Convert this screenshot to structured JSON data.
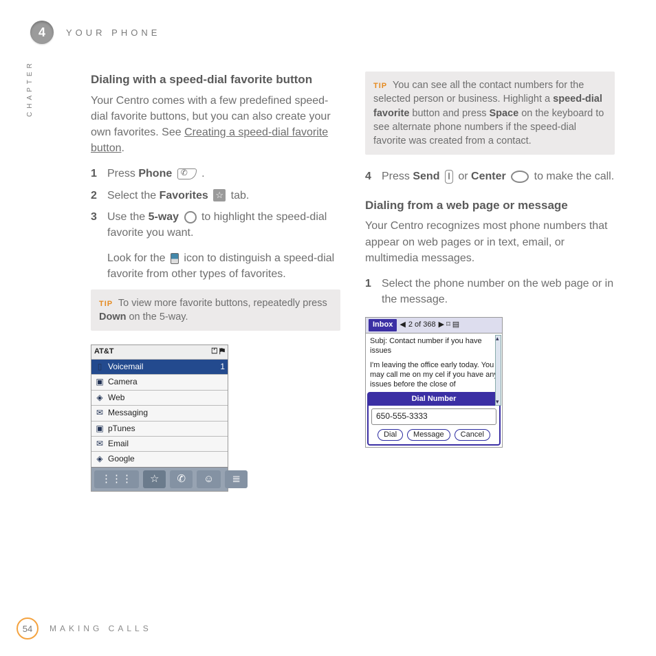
{
  "header": {
    "chapter_no": "4",
    "title": "YOUR PHONE",
    "side": "CHAPTER"
  },
  "left": {
    "h": "Dialing with a speed-dial favorite button",
    "intro_a": "Your Centro comes with a few predefined speed-dial favorite buttons, but you can also create your own favorites. See ",
    "intro_link": "Creating a speed-dial favorite button",
    "intro_b": ".",
    "s1_a": "Press ",
    "s1_b": "Phone",
    "s1_c": " .",
    "s2_a": "Select the ",
    "s2_b": "Favorites",
    "s2_c": " tab.",
    "s3_a": "Use the ",
    "s3_b": "5-way",
    "s3_c": " to highlight the speed-dial favorite you want.",
    "s3_look_a": "Look for the ",
    "s3_look_b": " icon to distinguish a speed-dial favorite from other types of favorites.",
    "tip_label": "TIP",
    "tip_a": " To view more favorite buttons, repeatedly press ",
    "tip_b": "Down",
    "tip_c": " on the 5-way.",
    "fav": {
      "carrier": "AT&T",
      "rows": [
        {
          "icon": "▯",
          "label": "Voicemail",
          "badge": "1",
          "sel": true
        },
        {
          "icon": "▣",
          "label": "Camera"
        },
        {
          "icon": "◈",
          "label": "Web"
        },
        {
          "icon": "✉",
          "label": "Messaging"
        },
        {
          "icon": "▣",
          "label": "pTunes"
        },
        {
          "icon": "✉",
          "label": "Email"
        },
        {
          "icon": "◈",
          "label": "Google"
        }
      ]
    }
  },
  "right": {
    "tip_label": "TIP",
    "tip_a": " You can see all the contact numbers for the selected person or business. Highlight a ",
    "tip_b": "speed-dial favorite",
    "tip_c": " button and press ",
    "tip_d": "Space",
    "tip_e": " on the keyboard to see alternate phone numbers if the speed-dial favorite was created from a contact.",
    "s4_a": "Press ",
    "s4_b": "Send",
    "s4_c": " or ",
    "s4_d": "Center",
    "s4_e": " to make the call.",
    "h2": "Dialing from a web page or message",
    "p2": "Your Centro recognizes most phone numbers that appear on web pages or in text, email, or multimedia messages.",
    "s1": "Select the phone number on the web page or in the message.",
    "inbox": {
      "label": "Inbox",
      "counter": "2 of 368",
      "subj": "Subj: Contact number if you have issues",
      "body": "I'm leaving the office early today. You may call me on my cel if you have any issues before the close of",
      "dlg_title": "Dial Number",
      "number": "650-555-3333",
      "btn1": "Dial",
      "btn2": "Message",
      "btn3": "Cancel"
    }
  },
  "footer": {
    "page": "54",
    "section": "MAKING CALLS"
  },
  "n": {
    "1": "1",
    "2": "2",
    "3": "3",
    "4": "4"
  }
}
